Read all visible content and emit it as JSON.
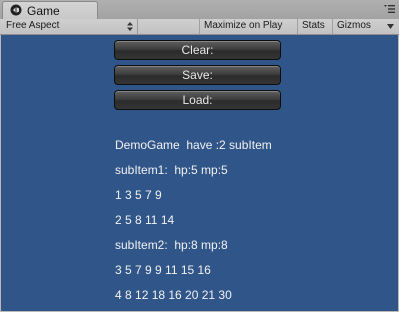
{
  "tab": {
    "title": "Game",
    "icon": "unity-logo-icon",
    "menu_icon": "panel-menu-icon"
  },
  "toolbar": {
    "aspect_label": "Free Aspect",
    "maximize_label": "Maximize on Play",
    "stats_label": "Stats",
    "gizmos_label": "Gizmos"
  },
  "colors": {
    "game_background": "#305589",
    "button_text": "#e8e8e8",
    "label_text": "#f2f2f2"
  },
  "game": {
    "buttons": {
      "clear": "Clear:",
      "save": "Save:",
      "load": "Load:"
    },
    "lines": [
      "DemoGame  have :2 subItem",
      "subItem1:  hp:5 mp:5",
      "1 3 5 7 9",
      "2 5 8 11 14",
      "subItem2:  hp:8 mp:8",
      "3 5 7 9 9 11 15 16",
      "4 8 12 18 16 20 21 30"
    ]
  }
}
